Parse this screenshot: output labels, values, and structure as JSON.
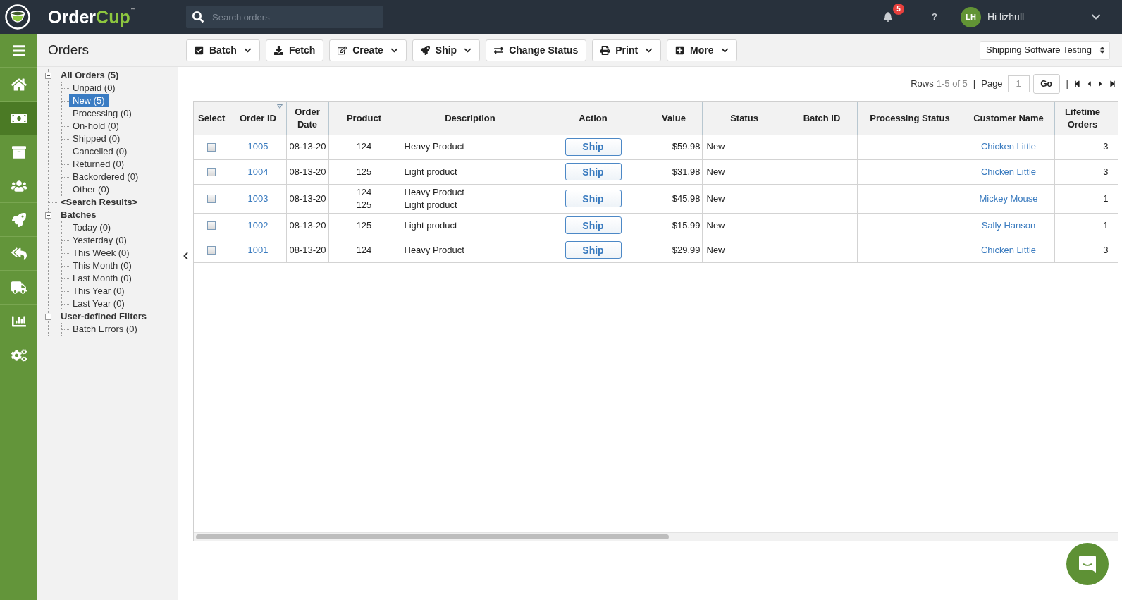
{
  "header": {
    "logo": {
      "primary": "Order",
      "accent": "Cup",
      "trademark": "™"
    },
    "search": {
      "placeholder": "Search orders"
    },
    "notifications": {
      "count": "5"
    },
    "help": "?",
    "user": {
      "initials": "LH",
      "greeting": "Hi lizhull"
    }
  },
  "nav": [
    {
      "selected": false
    },
    {
      "selected": true
    },
    {
      "selected": false
    },
    {
      "selected": false
    },
    {
      "selected": false
    },
    {
      "selected": false
    },
    {
      "selected": false
    },
    {
      "selected": false
    },
    {
      "selected": false
    }
  ],
  "page_title": "Orders",
  "toolbar": [
    {
      "label": "Batch",
      "dropdown": true
    },
    {
      "label": "Fetch",
      "dropdown": false
    },
    {
      "label": "Create",
      "dropdown": true
    },
    {
      "label": "Ship",
      "dropdown": true
    },
    {
      "label": "Change Status",
      "dropdown": false
    },
    {
      "label": "Print",
      "dropdown": true
    },
    {
      "label": "More",
      "dropdown": true
    }
  ],
  "account_select": {
    "value": "Shipping Software Testing"
  },
  "tree": [
    {
      "label": "All Orders (5)",
      "selected": false,
      "expanded": true,
      "children": [
        {
          "label": "Unpaid (0)",
          "selected": false
        },
        {
          "label": "New (5)",
          "selected": true
        },
        {
          "label": "Processing (0)",
          "selected": false
        },
        {
          "label": "On-hold (0)",
          "selected": false
        },
        {
          "label": "Shipped (0)",
          "selected": false
        },
        {
          "label": "Cancelled (0)",
          "selected": false
        },
        {
          "label": "Returned (0)",
          "selected": false
        },
        {
          "label": "Backordered (0)",
          "selected": false
        },
        {
          "label": "Other (0)",
          "selected": false
        }
      ]
    },
    {
      "label": "<Search Results>",
      "selected": false
    },
    {
      "label": "Batches",
      "selected": false,
      "expanded": true,
      "children": [
        {
          "label": "Today (0)",
          "selected": false
        },
        {
          "label": "Yesterday (0)",
          "selected": false
        },
        {
          "label": "This Week (0)",
          "selected": false
        },
        {
          "label": "This Month (0)",
          "selected": false
        },
        {
          "label": "Last Month (0)",
          "selected": false
        },
        {
          "label": "This Year (0)",
          "selected": false
        },
        {
          "label": "Last Year (0)",
          "selected": false
        }
      ]
    },
    {
      "label": "User-defined Filters",
      "selected": false,
      "expanded": true,
      "children": [
        {
          "label": "Batch Errors (0)",
          "selected": false
        }
      ]
    }
  ],
  "pager": {
    "rows_label": "Rows",
    "rows_range": "1-5 of 5",
    "separators": [
      "|",
      "|"
    ],
    "page_label": "Page",
    "page": "1",
    "go": "Go"
  },
  "table": {
    "columns": [
      {
        "label": "Select",
        "sorted": false
      },
      {
        "label": "Order ID",
        "sorted": true
      },
      {
        "label": "Order Date",
        "sorted": false
      },
      {
        "label": "Product",
        "sorted": false
      },
      {
        "label": "Description",
        "sorted": false
      },
      {
        "label": "Action",
        "sorted": false
      },
      {
        "label": "Value",
        "sorted": false
      },
      {
        "label": "Status",
        "sorted": false
      },
      {
        "label": "Batch ID",
        "sorted": false
      },
      {
        "label": "Processing Status",
        "sorted": false
      },
      {
        "label": "Customer Name",
        "sorted": false
      },
      {
        "label": "Lifetime Orders",
        "sorted": false
      }
    ],
    "rows": [
      {
        "checked": false,
        "order_id": "1005",
        "order_date": "08-13-20",
        "products": [
          "124"
        ],
        "descriptions": [
          "Heavy Product"
        ],
        "action": "Ship",
        "value": "$59.98",
        "status": "New",
        "customer": "Chicken Little",
        "lifetime_orders": "3"
      },
      {
        "checked": false,
        "order_id": "1004",
        "order_date": "08-13-20",
        "products": [
          "125"
        ],
        "descriptions": [
          "Light product"
        ],
        "action": "Ship",
        "value": "$31.98",
        "status": "New",
        "customer": "Chicken Little",
        "lifetime_orders": "3"
      },
      {
        "checked": false,
        "order_id": "1003",
        "order_date": "08-13-20",
        "products": [
          "124",
          "125"
        ],
        "descriptions": [
          "Heavy Product",
          "Light product"
        ],
        "action": "Ship",
        "value": "$45.98",
        "status": "New",
        "customer": "Mickey Mouse",
        "lifetime_orders": "1"
      },
      {
        "checked": false,
        "order_id": "1002",
        "order_date": "08-13-20",
        "products": [
          "125"
        ],
        "descriptions": [
          "Light product"
        ],
        "action": "Ship",
        "value": "$15.99",
        "status": "New",
        "customer": "Sally Hanson",
        "lifetime_orders": "1"
      },
      {
        "checked": false,
        "order_id": "1001",
        "order_date": "08-13-20",
        "products": [
          "124"
        ],
        "descriptions": [
          "Heavy Product"
        ],
        "action": "Ship",
        "value": "$29.99",
        "status": "New",
        "customer": "Chicken Little",
        "lifetime_orders": "3"
      }
    ]
  }
}
